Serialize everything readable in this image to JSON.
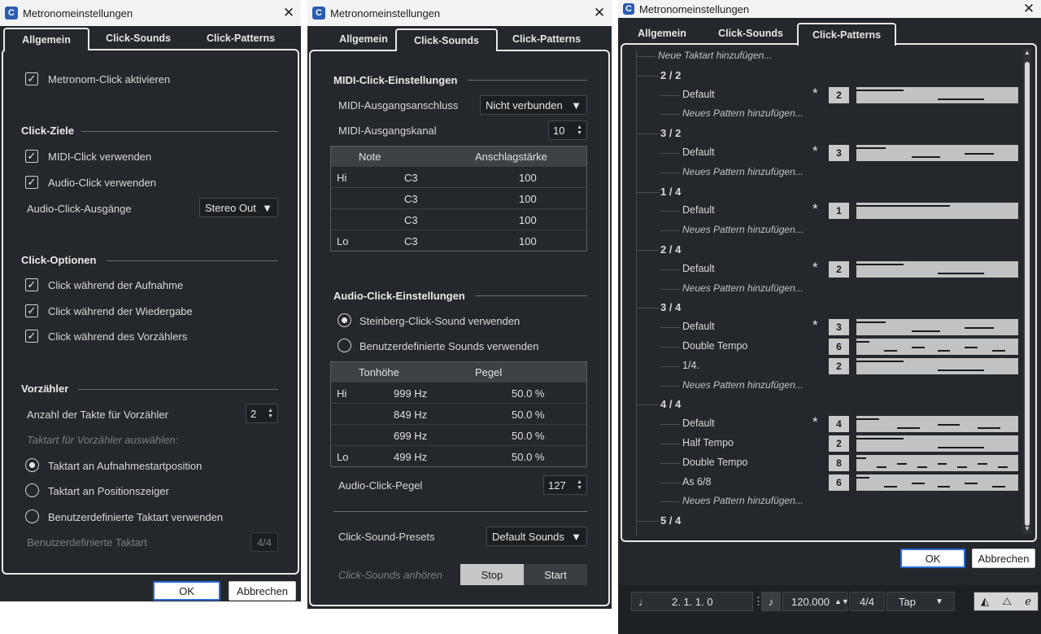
{
  "window_title": "Metronomeinstellungen",
  "tabs": [
    "Allgemein",
    "Click-Sounds",
    "Click-Patterns"
  ],
  "general": {
    "activate_click": "Metronom-Click aktivieren",
    "click_targets": {
      "heading": "Click-Ziele",
      "midi_click": "MIDI-Click verwenden",
      "audio_click": "Audio-Click verwenden",
      "outputs_label": "Audio-Click-Ausgänge",
      "outputs_value": "Stereo Out"
    },
    "click_options": {
      "heading": "Click-Optionen",
      "during_recording": "Click während der Aufnahme",
      "during_playback": "Click während der Wiedergabe",
      "during_precount": "Click während des Vorzählers"
    },
    "precount": {
      "heading": "Vorzähler",
      "bars_label": "Anzahl der Takte für Vorzähler",
      "bars_value": "2",
      "choose_signature": "Taktart für Vorzähler auswählen:",
      "opt_record_start": "Taktart an Aufnahmestartposition",
      "opt_cursor": "Taktart an Positionszeiger",
      "opt_custom": "Benutzerdefinierte Taktart verwenden",
      "custom_label": "Benutzerdefinierte Taktart",
      "custom_value": "4/4"
    }
  },
  "buttons": {
    "ok": "OK",
    "cancel": "Abbrechen"
  },
  "sounds": {
    "midi": {
      "heading": "MIDI-Click-Einstellungen",
      "port_label": "MIDI-Ausgangsanschluss",
      "port_value": "Nicht verbunden",
      "channel_label": "MIDI-Ausgangskanal",
      "channel_value": "10",
      "columns": [
        "Note",
        "Anschlagstärke"
      ],
      "rows": [
        {
          "tag": "Hi",
          "note": "C3",
          "vel": "100"
        },
        {
          "tag": "",
          "note": "C3",
          "vel": "100"
        },
        {
          "tag": "",
          "note": "C3",
          "vel": "100"
        },
        {
          "tag": "Lo",
          "note": "C3",
          "vel": "100"
        }
      ]
    },
    "audio": {
      "heading": "Audio-Click-Einstellungen",
      "opt_steinberg": "Steinberg-Click-Sound verwenden",
      "opt_custom": "Benutzerdefinierte Sounds verwenden",
      "columns": [
        "Tonhöhe",
        "Pegel"
      ],
      "rows": [
        {
          "tag": "Hi",
          "pitch": "999 Hz",
          "level": "50.0 %"
        },
        {
          "tag": "",
          "pitch": "849 Hz",
          "level": "50.0 %"
        },
        {
          "tag": "",
          "pitch": "699 Hz",
          "level": "50.0 %"
        },
        {
          "tag": "Lo",
          "pitch": "499 Hz",
          "level": "50.0 %"
        }
      ],
      "level_label": "Audio-Click-Pegel",
      "level_value": "127"
    },
    "presets_label": "Click-Sound-Presets",
    "presets_value": "Default Sounds",
    "listen_label": "Click-Sounds anhören",
    "stop": "Stop",
    "start": "Start"
  },
  "patterns": {
    "add_signature": "Neue Taktart hinzufügen...",
    "add_pattern": "Neues Pattern hinzufügen...",
    "groups": [
      {
        "sig": "2 / 2",
        "patterns": [
          {
            "name": "Default",
            "count": "2",
            "star": "*"
          }
        ]
      },
      {
        "sig": "3 / 2",
        "patterns": [
          {
            "name": "Default",
            "count": "3",
            "star": "*"
          }
        ]
      },
      {
        "sig": "1 / 4",
        "patterns": [
          {
            "name": "Default",
            "count": "1",
            "star": "*"
          }
        ]
      },
      {
        "sig": "2 / 4",
        "patterns": [
          {
            "name": "Default",
            "count": "2",
            "star": "*"
          }
        ]
      },
      {
        "sig": "3 / 4",
        "patterns": [
          {
            "name": "Default",
            "count": "3",
            "star": "*"
          },
          {
            "name": "Double Tempo",
            "count": "6",
            "star": ""
          },
          {
            "name": "1/4.",
            "count": "2",
            "star": ""
          }
        ]
      },
      {
        "sig": "4 / 4",
        "patterns": [
          {
            "name": "Default",
            "count": "4",
            "star": "*"
          },
          {
            "name": "Half Tempo",
            "count": "2",
            "star": ""
          },
          {
            "name": "Double Tempo",
            "count": "8",
            "star": ""
          },
          {
            "name": "As 6/8",
            "count": "6",
            "star": ""
          }
        ]
      },
      {
        "sig": "5 / 4",
        "patterns": []
      }
    ]
  },
  "transport": {
    "position": "2. 1. 1.    0",
    "tempo": "120.000",
    "signature": "4/4",
    "tap": "Tap"
  }
}
